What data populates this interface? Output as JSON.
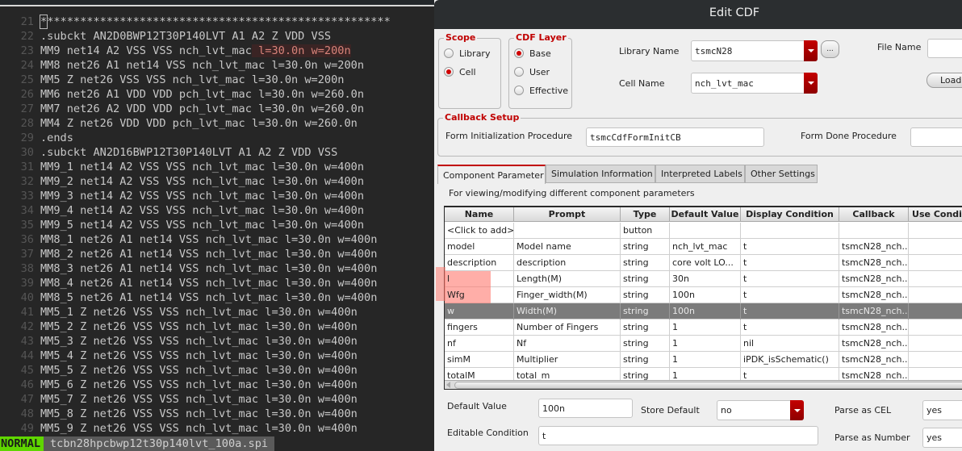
{
  "editor": {
    "lines": [
      {
        "n": "21",
        "text": "*****************************************************",
        "cursor_first_char": true
      },
      {
        "n": "22",
        "text": ".subckt AN2D0BWP12T30P140LVT A1 A2 Z VDD VSS"
      },
      {
        "n": "23",
        "text": "MM9 net14 A2 VSS VSS nch_lvt_mac",
        "highlight": " l=30.0n w=200n"
      },
      {
        "n": "24",
        "text": "MM8 net26 A1 net14 VSS nch_lvt_mac l=30.0n w=200n"
      },
      {
        "n": "25",
        "text": "MM5 Z net26 VSS VSS nch_lvt_mac l=30.0n w=200n"
      },
      {
        "n": "26",
        "text": "MM6 net26 A1 VDD VDD pch_lvt_mac l=30.0n w=260.0n"
      },
      {
        "n": "27",
        "text": "MM7 net26 A2 VDD VDD pch_lvt_mac l=30.0n w=260.0n"
      },
      {
        "n": "28",
        "text": "MM4 Z net26 VDD VDD pch_lvt_mac l=30.0n w=260.0n"
      },
      {
        "n": "29",
        "text": ".ends"
      },
      {
        "n": "30",
        "text": ".subckt AN2D16BWP12T30P140LVT A1 A2 Z VDD VSS"
      },
      {
        "n": "31",
        "text": "MM9_1 net14 A2 VSS VSS nch_lvt_mac l=30.0n w=400n"
      },
      {
        "n": "32",
        "text": "MM9_2 net14 A2 VSS VSS nch_lvt_mac l=30.0n w=400n"
      },
      {
        "n": "33",
        "text": "MM9_3 net14 A2 VSS VSS nch_lvt_mac l=30.0n w=400n"
      },
      {
        "n": "34",
        "text": "MM9_4 net14 A2 VSS VSS nch_lvt_mac l=30.0n w=400n"
      },
      {
        "n": "35",
        "text": "MM9_5 net14 A2 VSS VSS nch_lvt_mac l=30.0n w=400n"
      },
      {
        "n": "36",
        "text": "MM8_1 net26 A1 net14 VSS nch_lvt_mac l=30.0n w=400n"
      },
      {
        "n": "37",
        "text": "MM8_2 net26 A1 net14 VSS nch_lvt_mac l=30.0n w=400n"
      },
      {
        "n": "38",
        "text": "MM8_3 net26 A1 net14 VSS nch_lvt_mac l=30.0n w=400n"
      },
      {
        "n": "39",
        "text": "MM8_4 net26 A1 net14 VSS nch_lvt_mac l=30.0n w=400n"
      },
      {
        "n": "40",
        "text": "MM8_5 net26 A1 net14 VSS nch_lvt_mac l=30.0n w=400n"
      },
      {
        "n": "41",
        "text": "MM5_1 Z net26 VSS VSS nch_lvt_mac l=30.0n w=400n"
      },
      {
        "n": "42",
        "text": "MM5_2 Z net26 VSS VSS nch_lvt_mac l=30.0n w=400n"
      },
      {
        "n": "43",
        "text": "MM5_3 Z net26 VSS VSS nch_lvt_mac l=30.0n w=400n"
      },
      {
        "n": "44",
        "text": "MM5_4 Z net26 VSS VSS nch_lvt_mac l=30.0n w=400n"
      },
      {
        "n": "45",
        "text": "MM5_5 Z net26 VSS VSS nch_lvt_mac l=30.0n w=400n"
      },
      {
        "n": "46",
        "text": "MM5_6 Z net26 VSS VSS nch_lvt_mac l=30.0n w=400n"
      },
      {
        "n": "47",
        "text": "MM5_7 Z net26 VSS VSS nch_lvt_mac l=30.0n w=400n"
      },
      {
        "n": "48",
        "text": "MM5_8 Z net26 VSS VSS nch_lvt_mac l=30.0n w=400n"
      },
      {
        "n": "49",
        "text": "MM5_9 Z net26 VSS VSS nch_lvt_mac l=30.0n w=400n"
      }
    ],
    "status": {
      "mode": "NORMAL",
      "filename": "tcbn28hpcbwp12t30p140lvt_100a.spi"
    }
  },
  "dialog": {
    "title": "Edit CDF",
    "scope": {
      "title": "Scope",
      "options": [
        {
          "label": "Library",
          "selected": false
        },
        {
          "label": "Cell",
          "selected": true
        }
      ]
    },
    "cdf_layer": {
      "title": "CDF Layer",
      "options": [
        {
          "label": "Base",
          "selected": true
        },
        {
          "label": "User",
          "selected": false
        },
        {
          "label": "Effective",
          "selected": false
        }
      ]
    },
    "library_name": {
      "label": "Library Name",
      "value": "tsmcN28",
      "browse_label": "..."
    },
    "cell_name": {
      "label": "Cell Name",
      "value": "nch_lvt_mac"
    },
    "file_name": {
      "label": "File Name",
      "value": ""
    },
    "load_label": "Load",
    "callback_setup": {
      "title": "Callback Setup",
      "form_init_label": "Form Initialization Procedure",
      "form_init_value": "tsmcCdfFormInitCB",
      "form_done_label": "Form Done Procedure",
      "form_done_value": ""
    },
    "tabs": [
      {
        "label": "Component Parameter",
        "active": true
      },
      {
        "label": "Simulation Information",
        "active": false
      },
      {
        "label": "Interpreted Labels",
        "active": false
      },
      {
        "label": "Other Settings",
        "active": false
      }
    ],
    "tab_description": "For viewing/modifying different component parameters",
    "table": {
      "columns": [
        "Name",
        "Prompt",
        "Type",
        "Default Value",
        "Display Condition",
        "Callback",
        "Use Conditi"
      ],
      "rows": [
        [
          "<Click to add>",
          "",
          "button",
          "",
          "",
          "",
          ""
        ],
        [
          "model",
          "Model name",
          "string",
          "nch_lvt_mac",
          "t",
          "tsmcN28_nch...",
          ""
        ],
        [
          "description",
          "description",
          "string",
          " core volt LO...",
          "t",
          "tsmcN28_nch...",
          ""
        ],
        [
          "l",
          "Length(M)",
          "string",
          "30n",
          "t",
          "tsmcN28_nch...",
          ""
        ],
        [
          "Wfg",
          "Finger_width(M)",
          "string",
          "100n",
          "t",
          "tsmcN28_nch...",
          ""
        ],
        [
          "w",
          "Width(M)",
          "string",
          "100n",
          "t",
          "tsmcN28_nch...",
          ""
        ],
        [
          "fingers",
          "Number of Fingers",
          "string",
          "1",
          "t",
          "tsmcN28_nch...",
          ""
        ],
        [
          "nf",
          "Nf",
          "string",
          "1",
          "nil",
          "tsmcN28_nch...",
          ""
        ],
        [
          "simM",
          "Multiplier",
          "string",
          "1",
          "iPDK_isSchematic()",
          "tsmcN28_nch...",
          ""
        ],
        [
          "totalM",
          "total_m",
          "string",
          "1",
          "t",
          "tsmcN28_nch...",
          ""
        ]
      ],
      "selected_row": 5,
      "marked_rows": [
        3,
        4
      ]
    },
    "bottom": {
      "default_value_label": "Default Value",
      "default_value": "100n",
      "store_default_label": "Store Default",
      "store_default_value": "no",
      "parse_cel_label": "Parse as CEL",
      "parse_cel_value": "yes",
      "editable_condition_label": "Editable Condition",
      "editable_condition_value": "t",
      "parse_number_label": "Parse as Number",
      "parse_number_value": "yes"
    }
  }
}
